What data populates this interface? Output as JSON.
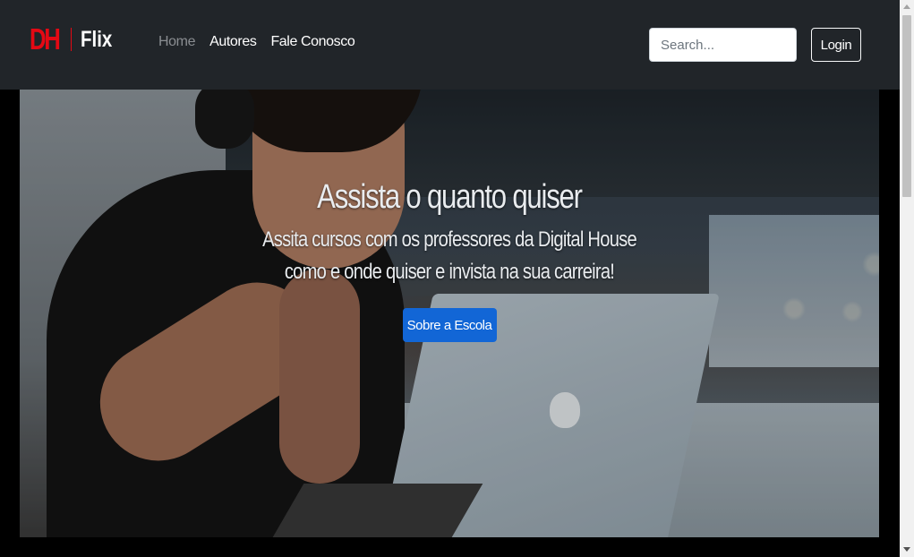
{
  "navbar": {
    "brand": {
      "logo_text": "DH",
      "name": "Flix"
    },
    "links": [
      {
        "label": "Home",
        "state": "muted"
      },
      {
        "label": "Autores",
        "state": "normal"
      },
      {
        "label": "Fale Conosco",
        "state": "normal"
      }
    ],
    "search": {
      "placeholder": "Search...",
      "value": ""
    },
    "login_label": "Login"
  },
  "hero": {
    "title": "Assista o quanto quiser",
    "subtitle": "Assita cursos com os professores da Digital House como e onde quiser e invista na sua carreira!",
    "button_label": "Sobre a Escola"
  },
  "colors": {
    "navbar_bg": "#212529",
    "brand_red": "#e50914",
    "primary_button": "#1266d6"
  }
}
